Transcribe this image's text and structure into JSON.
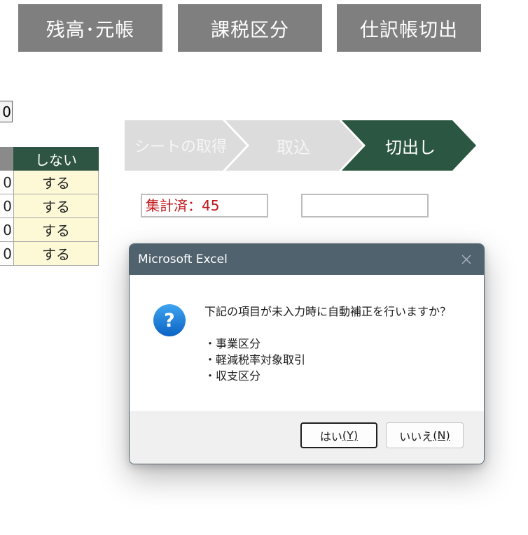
{
  "toolbar": {
    "buttons": [
      {
        "label": "残高･元帳"
      },
      {
        "label": "課税区分"
      },
      {
        "label": "仕訳帳切出"
      }
    ]
  },
  "sheet": {
    "zero_cell": "0",
    "table": {
      "header": {
        "left": "",
        "right": "しない"
      },
      "rows": [
        {
          "left": "0",
          "right": "する"
        },
        {
          "left": "0",
          "right": "する"
        },
        {
          "left": "0",
          "right": "する"
        },
        {
          "left": "0",
          "right": "する"
        }
      ]
    }
  },
  "steps": {
    "items": [
      {
        "label": "シートの取得",
        "state": "inactive"
      },
      {
        "label": "取込",
        "state": "inactive"
      },
      {
        "label": "切出し",
        "state": "active"
      }
    ],
    "colors": {
      "inactive": "#dcdcdc",
      "active": "#2b5641",
      "inactive_text": "#f5f5f5"
    }
  },
  "status": {
    "left_text": "集計済：45",
    "right_text": ""
  },
  "dialog": {
    "title": "Microsoft Excel",
    "icon": "question-icon",
    "message_lines": [
      "下記の項目が未入力時に自動補正を行いますか？",
      "",
      "・事業区分",
      "・軽減税率対象取引",
      "・収支区分"
    ],
    "yes_button": {
      "label": "はい",
      "mnemonic": "(Y)"
    },
    "no_button": {
      "label": "いいえ",
      "mnemonic": "(N)"
    }
  }
}
